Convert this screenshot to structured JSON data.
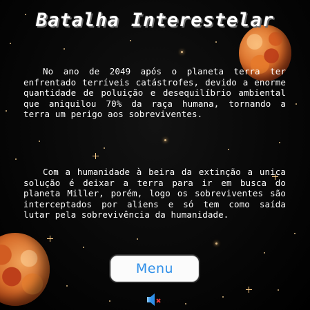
{
  "game": {
    "title": "Batalha Interestelar",
    "paragraphs": [
      "No ano de 2049 após o planeta terra ter enfrentado terríveis catástrofes, devido a enorme quantidade de poluição e desequilíbrio ambiental que aniquilou 70% da raça humana, tornando a terra um perigo aos sobreviventes.",
      "Com a humanidade à beira da extinção a unica solução é deixar a terra para ir em busca do planeta Miller, porém, logo os sobreviventes são interceptados por aliens e só tem como saída lutar pela sobrevivência da humanidade."
    ],
    "menu_label": "Menu",
    "sound": {
      "icon": "speaker-muted-icon",
      "state": "muted"
    }
  },
  "colors": {
    "background": "#000000",
    "text": "#ffffff",
    "button_text": "#2f8fe8",
    "button_bg": "#fbfbfb",
    "planet": "#d86e2b",
    "mute_x": "#e53935"
  }
}
